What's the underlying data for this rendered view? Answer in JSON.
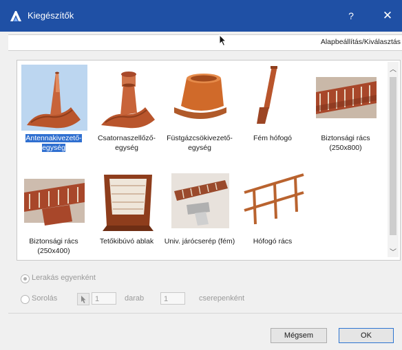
{
  "window": {
    "title": "Kiegészítők",
    "help_label": "?",
    "close_label": "✕"
  },
  "settings": {
    "link_label": "Alapbeállítás/Kiválasztás"
  },
  "gallery": {
    "items": [
      {
        "label": "Antennakivezető-egység",
        "selected": true
      },
      {
        "label": "Csatornaszellőző-egység",
        "selected": false
      },
      {
        "label": "Füstgázcsökivezető-egység",
        "selected": false
      },
      {
        "label": "Fém hófogó",
        "selected": false
      },
      {
        "label": "Biztonsági rács (250x800)",
        "selected": false
      },
      {
        "label": "Biztonsági rács (250x400)",
        "selected": false
      },
      {
        "label": "Tetőkibúvó ablak",
        "selected": false
      },
      {
        "label": "Univ. járócserép (fém)",
        "selected": false
      },
      {
        "label": "Hófogó rács",
        "selected": false
      }
    ]
  },
  "options": {
    "single_label": "Lerakás egyenként",
    "row_label": "Sorolás",
    "count_value": "1",
    "count_unit": "darab",
    "spacing_value": "1",
    "spacing_unit": "cserepenként"
  },
  "buttons": {
    "cancel": "Mégsem",
    "ok": "OK"
  },
  "colors": {
    "titlebar": "#1f50a5",
    "selection": "#2f6fd0",
    "terracotta": "#c8643a"
  }
}
